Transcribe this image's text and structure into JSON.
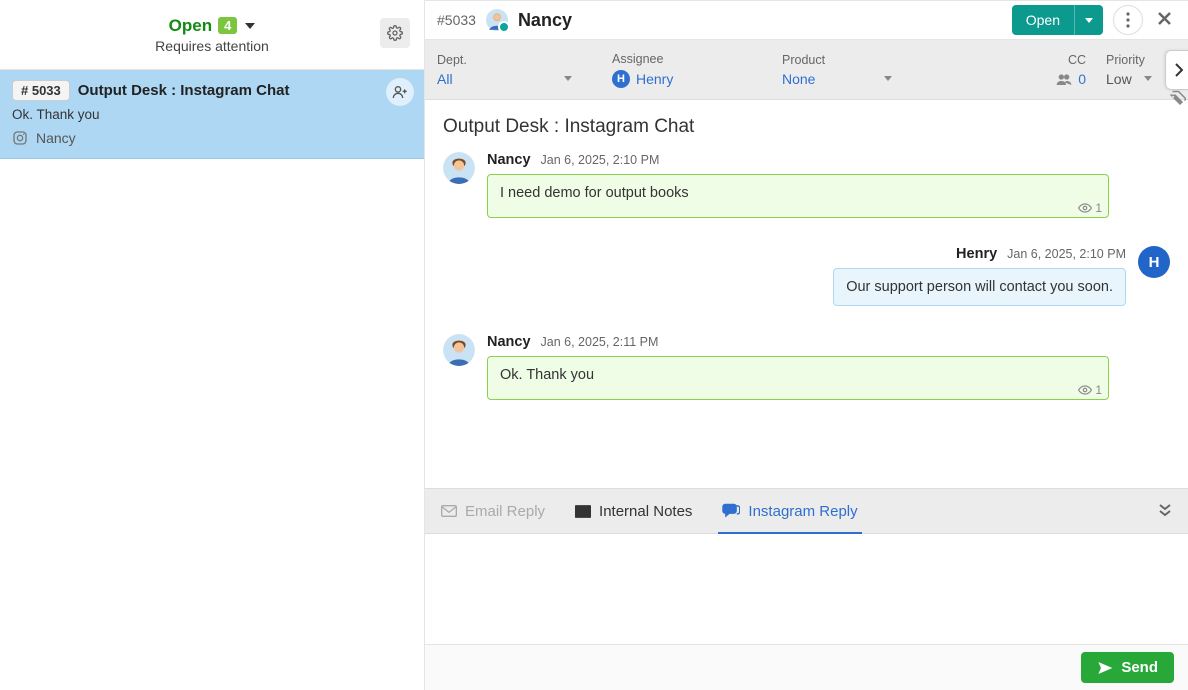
{
  "left": {
    "status": "Open",
    "count": "4",
    "subheading": "Requires attention",
    "ticket": {
      "id": "# 5033",
      "title": "Output Desk : Instagram Chat",
      "snippet": "Ok. Thank you",
      "channel": "Nancy"
    }
  },
  "right": {
    "hash": "#5033",
    "requester": "Nancy",
    "open_btn": "Open",
    "meta": {
      "dept_label": "Dept.",
      "dept_value": "All",
      "assignee_label": "Assignee",
      "assignee_initial": "H",
      "assignee_value": "Henry",
      "product_label": "Product",
      "product_value": "None",
      "cc_label": "CC",
      "cc_value": "0",
      "priority_label": "Priority",
      "priority_value": "Low"
    },
    "conv_title": "Output Desk : Instagram Chat",
    "messages": [
      {
        "side": "left",
        "name": "Nancy",
        "time": "Jan 6, 2025, 2:10 PM",
        "text": "I need demo for output books",
        "seen": "1"
      },
      {
        "side": "right",
        "name": "Henry",
        "time": "Jan 6, 2025, 2:10 PM",
        "text": "Our support person will contact you soon."
      },
      {
        "side": "left",
        "name": "Nancy",
        "time": "Jan 6, 2025, 2:11 PM",
        "text": "Ok. Thank you",
        "seen": "1"
      }
    ],
    "reply_tabs": {
      "email": "Email Reply",
      "notes": "Internal Notes",
      "instagram": "Instagram Reply"
    },
    "send": "Send",
    "henry_initial": "H"
  }
}
